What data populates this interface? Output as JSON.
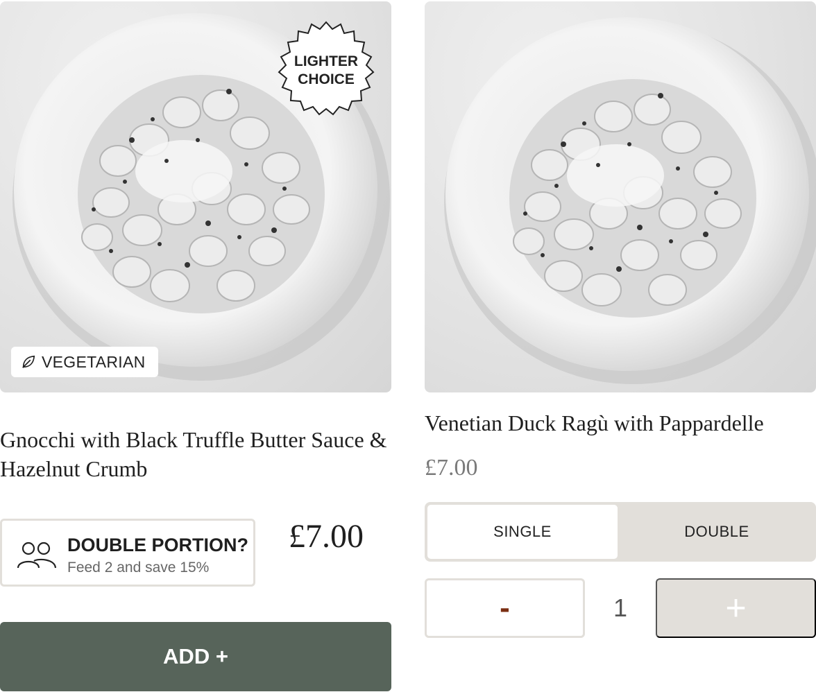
{
  "products": [
    {
      "badge_diet": "VEGETARIAN",
      "badge_lighter_line1": "LIGHTER",
      "badge_lighter_line2": "CHOICE",
      "title": "Gnocchi with Black Truffle Butter Sauce & Hazelnut Crumb",
      "double_portion_heading": "DOUBLE PORTION?",
      "double_portion_sub": "Feed 2 and save 15%",
      "price": "£7.00",
      "add_label": "ADD +"
    },
    {
      "title": "Venetian Duck Ragù with Pappardelle",
      "price": "£7.00",
      "size_options": [
        "SINGLE",
        "DOUBLE"
      ],
      "selected_size": "SINGLE",
      "minus_label": "-",
      "quantity": "1",
      "plus_label": "+"
    }
  ],
  "icons": {
    "diet": "leaf-icon",
    "portion": "people-icon"
  },
  "colors": {
    "add_button": "#57645a",
    "minus": "#7a2e12",
    "toggle_bg": "#e2dfda"
  }
}
